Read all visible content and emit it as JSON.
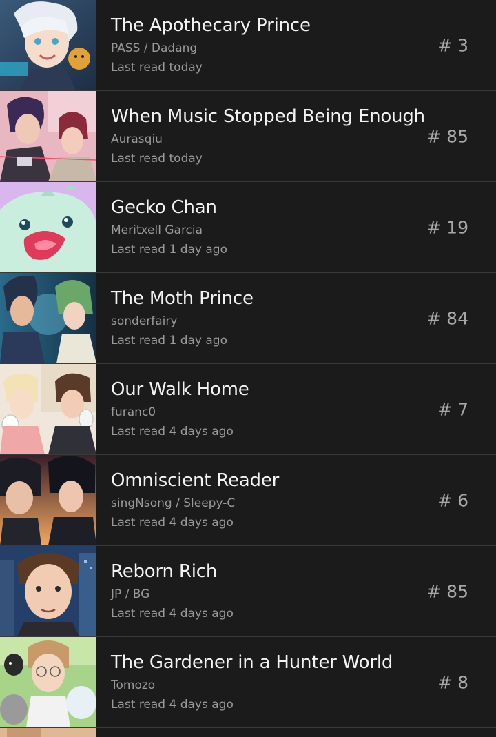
{
  "list": {
    "items": [
      {
        "title": "The Apothecary Prince",
        "author": "PASS / Dadang",
        "last_read": "Last read today",
        "episode": "# 3",
        "thumb": "thumbnail-white-haired-prince"
      },
      {
        "title": "When Music Stopped Being Enough",
        "author": "Aurasqiu",
        "last_read": "Last read today",
        "episode": "# 85",
        "thumb": "thumbnail-two-boys-pink"
      },
      {
        "title": "Gecko Chan",
        "author": "Meritxell Garcia",
        "last_read": "Last read 1 day ago",
        "episode": "# 19",
        "thumb": "thumbnail-green-gecko"
      },
      {
        "title": "The Moth Prince",
        "author": "sonderfairy",
        "last_read": "Last read 1 day ago",
        "episode": "# 84",
        "thumb": "thumbnail-two-boys-night"
      },
      {
        "title": "Our Walk Home",
        "author": "furanc0",
        "last_read": "Last read 4 days ago",
        "episode": "# 7",
        "thumb": "thumbnail-boys-with-masks"
      },
      {
        "title": "Omniscient Reader",
        "author": "singNsong / Sleepy-C",
        "last_read": "Last read 4 days ago",
        "episode": "# 6",
        "thumb": "thumbnail-two-dark-haired-men"
      },
      {
        "title": "Reborn Rich",
        "author": "JP / BG",
        "last_read": "Last read 4 days ago",
        "episode": "# 85",
        "thumb": "thumbnail-man-city"
      },
      {
        "title": "The Gardener in a Hunter World",
        "author": "Tomozo",
        "last_read": "Last read 4 days ago",
        "episode": "# 8",
        "thumb": "thumbnail-gardener-with-animals"
      }
    ]
  }
}
